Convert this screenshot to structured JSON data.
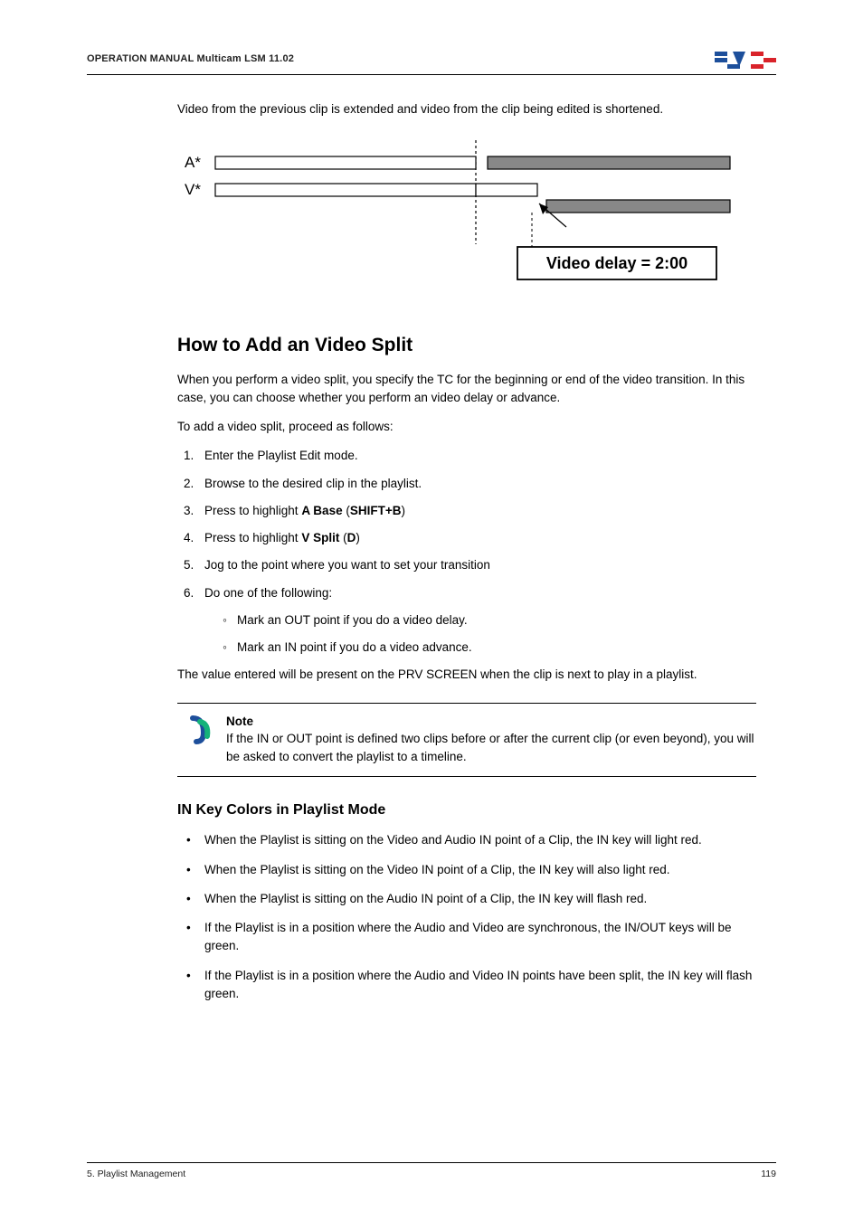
{
  "header": {
    "title_left": "OPERATION MANUAL Multicam LSM 11.02"
  },
  "intro": "Video from the previous clip is extended and video from the clip being edited is shortened.",
  "diagram": {
    "label_a": "A*",
    "label_v": "V*",
    "delay_text": "Video delay = 2:00"
  },
  "section": {
    "heading": "How to Add an Video Split",
    "p1": "When you perform a video split, you specify the TC for the beginning or end of the video transition. In this case, you can choose whether you perform an video delay or advance.",
    "p2": "To add a video split, proceed as follows:",
    "steps": {
      "s1": "Enter the Playlist Edit mode.",
      "s2": "Browse to the desired clip in the playlist.",
      "s3_pre": "Press to highlight ",
      "s3_b1": "A Base",
      "s3_mid": " (",
      "s3_b2": "SHIFT+B",
      "s3_post": ")",
      "s4_pre": "Press to highlight ",
      "s4_b1": "V Split",
      "s4_mid": " (",
      "s4_b2": "D",
      "s4_post": ")",
      "s5": "Jog to the point where you want to set your transition",
      "s6": "Do one of the following:",
      "s6a": "Mark an OUT point if you do a video delay.",
      "s6b": "Mark an IN point if you do a video advance."
    },
    "closing": "The value entered will be present on the PRV SCREEN when the clip is next to play in a playlist."
  },
  "note": {
    "heading": "Note",
    "body": "If the IN or OUT point is defined two clips before or after the current clip (or even beyond), you will be asked to convert the playlist to a timeline."
  },
  "subsection": {
    "heading": "IN Key Colors in Playlist Mode",
    "b1": "When the Playlist is sitting on the Video and Audio IN point of a Clip, the IN key will light red.",
    "b2": "When the Playlist is sitting on the Video IN point of a Clip, the IN key will also light red.",
    "b3": "When the Playlist is sitting on the Audio IN point of a Clip, the IN key will flash red.",
    "b4": "If the Playlist is in a position where the Audio and Video are synchronous, the IN/OUT keys will be green.",
    "b5": "If the Playlist is in a position where the Audio and Video IN points have been split, the IN key will flash green."
  },
  "footer": {
    "left": "5. Playlist Management",
    "right": "119"
  }
}
